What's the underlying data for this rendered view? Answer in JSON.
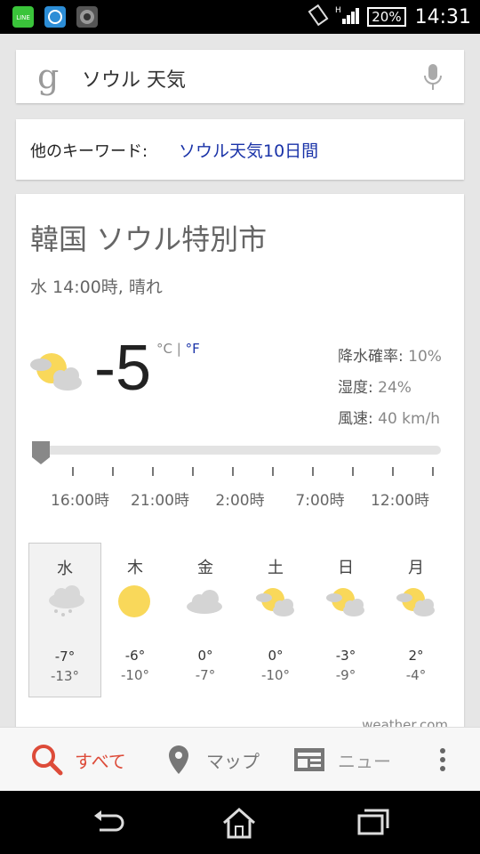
{
  "status": {
    "battery": "20%",
    "time": "14:31",
    "signal_label": "H"
  },
  "search": {
    "query": "ソウル 天気"
  },
  "keywords": {
    "label": "他のキーワード:",
    "link": "ソウル天気10日間"
  },
  "weather": {
    "location": "韓国 ソウル特別市",
    "condition": "水 14:00時, 晴れ",
    "temp": "-5",
    "unit_c": "°C",
    "sep": " | ",
    "unit_f": "°F",
    "precip": {
      "label": "降水確率:",
      "value": "10%"
    },
    "humidity": {
      "label": "湿度:",
      "value": "24%"
    },
    "wind": {
      "label": "風速:",
      "value": "40 km/h"
    },
    "timeline": [
      "16:00時",
      "21:00時",
      "2:00時",
      "7:00時",
      "12:00時"
    ],
    "days": [
      {
        "name": "水",
        "hi": "-7°",
        "lo": "-13°",
        "icon": "snow-cloud-icon"
      },
      {
        "name": "木",
        "hi": "-6°",
        "lo": "-10°",
        "icon": "sun-icon"
      },
      {
        "name": "金",
        "hi": "0°",
        "lo": "-7°",
        "icon": "cloud-icon"
      },
      {
        "name": "土",
        "hi": "0°",
        "lo": "-10°",
        "icon": "partly-cloudy-icon"
      },
      {
        "name": "日",
        "hi": "-3°",
        "lo": "-9°",
        "icon": "partly-cloudy-icon"
      },
      {
        "name": "月",
        "hi": "2°",
        "lo": "-4°",
        "icon": "partly-cloudy-icon"
      }
    ],
    "source": "weather.com"
  },
  "tabs": {
    "all": "すべて",
    "maps": "マップ",
    "news": "ニュー"
  },
  "colors": {
    "accent_red": "#dd4b39",
    "link_blue": "#1a33a8",
    "sun": "#f9d85a"
  }
}
